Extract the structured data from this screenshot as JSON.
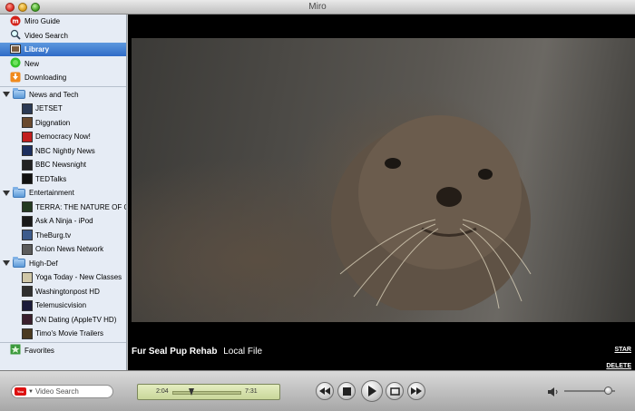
{
  "window": {
    "title": "Miro"
  },
  "sidebar": {
    "top_items": [
      {
        "label": "Miro Guide",
        "icon": "miro-logo-icon"
      },
      {
        "label": "Video Search",
        "icon": "magnifier-icon"
      },
      {
        "label": "Library",
        "icon": "library-icon",
        "selected": true
      },
      {
        "label": "New",
        "icon": "new-badge-icon"
      },
      {
        "label": "Downloading",
        "icon": "download-icon"
      }
    ],
    "folders": [
      {
        "label": "News and Tech",
        "channels": [
          {
            "label": "JETSET",
            "color": "#2b3a55"
          },
          {
            "label": "Diggnation",
            "color": "#6a4a2f"
          },
          {
            "label": "Democracy Now!",
            "color": "#c21f1f"
          },
          {
            "label": "NBC Nightly News",
            "color": "#1d2f5e"
          },
          {
            "label": "BBC Newsnight",
            "color": "#222222"
          },
          {
            "label": "TEDTalks",
            "color": "#111111"
          }
        ]
      },
      {
        "label": "Entertainment",
        "channels": [
          {
            "label": "TERRA: THE NATURE OF OUR WORLD",
            "color": "#243b22"
          },
          {
            "label": "Ask A Ninja - iPod",
            "color": "#1a1a1a"
          },
          {
            "label": "TheBurg.tv",
            "color": "#3d5b8c"
          },
          {
            "label": "Onion News Network",
            "color": "#5b5b5b"
          }
        ]
      },
      {
        "label": "High-Def",
        "channels": [
          {
            "label": "Yoga Today - New Classes",
            "color": "#cfc7a8"
          },
          {
            "label": "Washingtonpost HD",
            "color": "#2f2f2f"
          },
          {
            "label": "Telemusicvision",
            "color": "#1b1b3a"
          },
          {
            "label": "ON Dating (AppleTV HD)",
            "color": "#3a1f2d"
          },
          {
            "label": "Timo's Movie Trailers",
            "color": "#4a3a20"
          }
        ]
      }
    ],
    "bottom_items": [
      {
        "label": "Favorites",
        "icon": "favorites-icon"
      }
    ]
  },
  "player": {
    "title": "Fur Seal Pup Rehab",
    "subtitle": "Local File",
    "star_label": "STAR",
    "delete_label": "DELETE"
  },
  "bottombar": {
    "search_placeholder": "Video Search",
    "time_elapsed": "2:04",
    "time_total": "7:31",
    "progress_fraction": 0.28,
    "volume_fraction": 0.86
  }
}
